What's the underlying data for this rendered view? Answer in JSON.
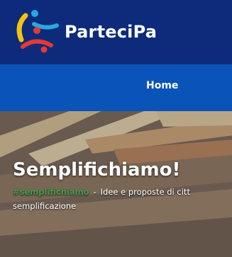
{
  "brand": {
    "name": "ParteciPa",
    "colors": {
      "blue": "#0d2b7a",
      "red": "#e53935",
      "yellow": "#f1c40f",
      "light_blue": "#2aa8e0"
    }
  },
  "nav": {
    "items": [
      {
        "label": "Home"
      }
    ]
  },
  "hero": {
    "title": "Semplifichiamo!",
    "hashtag": "#semplifichiamo",
    "separator": "-",
    "subtitle_line1": "Idee e proposte di citt",
    "subtitle_line2": "semplificazione"
  }
}
